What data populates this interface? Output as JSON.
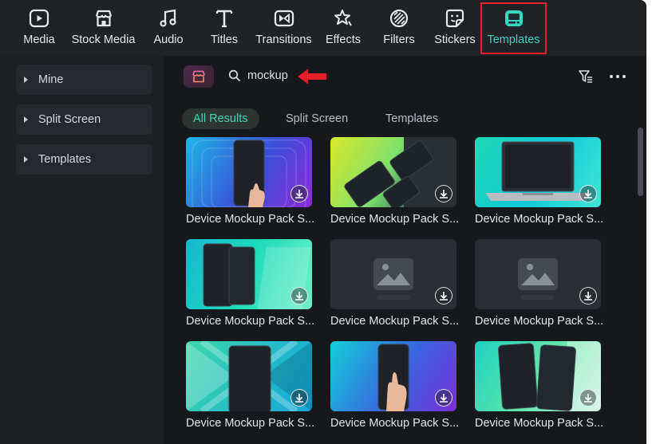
{
  "toolbar": {
    "items": [
      {
        "label": "Media",
        "icon": "media-icon"
      },
      {
        "label": "Stock Media",
        "icon": "stock-media-icon"
      },
      {
        "label": "Audio",
        "icon": "music-note-icon"
      },
      {
        "label": "Titles",
        "icon": "titles-t-icon"
      },
      {
        "label": "Transitions",
        "icon": "transitions-icon"
      },
      {
        "label": "Effects",
        "icon": "effects-star-icon"
      },
      {
        "label": "Filters",
        "icon": "filters-icon"
      },
      {
        "label": "Stickers",
        "icon": "stickers-icon"
      },
      {
        "label": "Templates",
        "icon": "templates-icon",
        "active": true
      }
    ],
    "active_color": "#34d7c0",
    "highlight_color": "#e8222d"
  },
  "sidebar": {
    "items": [
      {
        "label": "Mine"
      },
      {
        "label": "Split Screen"
      },
      {
        "label": "Templates"
      }
    ]
  },
  "search": {
    "value": "mockup",
    "annotation": "red-arrow-icon"
  },
  "tabs": [
    {
      "label": "All Results",
      "active": true
    },
    {
      "label": "Split Screen"
    },
    {
      "label": "Templates"
    }
  ],
  "results": [
    {
      "caption": "Device Mockup Pack S...",
      "style": "phone-blue-purple"
    },
    {
      "caption": "Device Mockup Pack S...",
      "style": "diagonal-yellow-green"
    },
    {
      "caption": "Device Mockup Pack S...",
      "style": "laptop-teal"
    },
    {
      "caption": "Device Mockup Pack S...",
      "style": "dual-phones-teal"
    },
    {
      "caption": "Device Mockup Pack S...",
      "style": "placeholder"
    },
    {
      "caption": "Device Mockup Pack S...",
      "style": "placeholder"
    },
    {
      "caption": "Device Mockup Pack S...",
      "style": "phone-teal-x"
    },
    {
      "caption": "Device Mockup Pack S...",
      "style": "phone-hand-blue"
    },
    {
      "caption": "Device Mockup Pack S...",
      "style": "dual-phones-green"
    }
  ],
  "colors": {
    "panel_bg": "#17181c",
    "toolbar_bg": "#202226",
    "accent": "#3fd6b5"
  }
}
